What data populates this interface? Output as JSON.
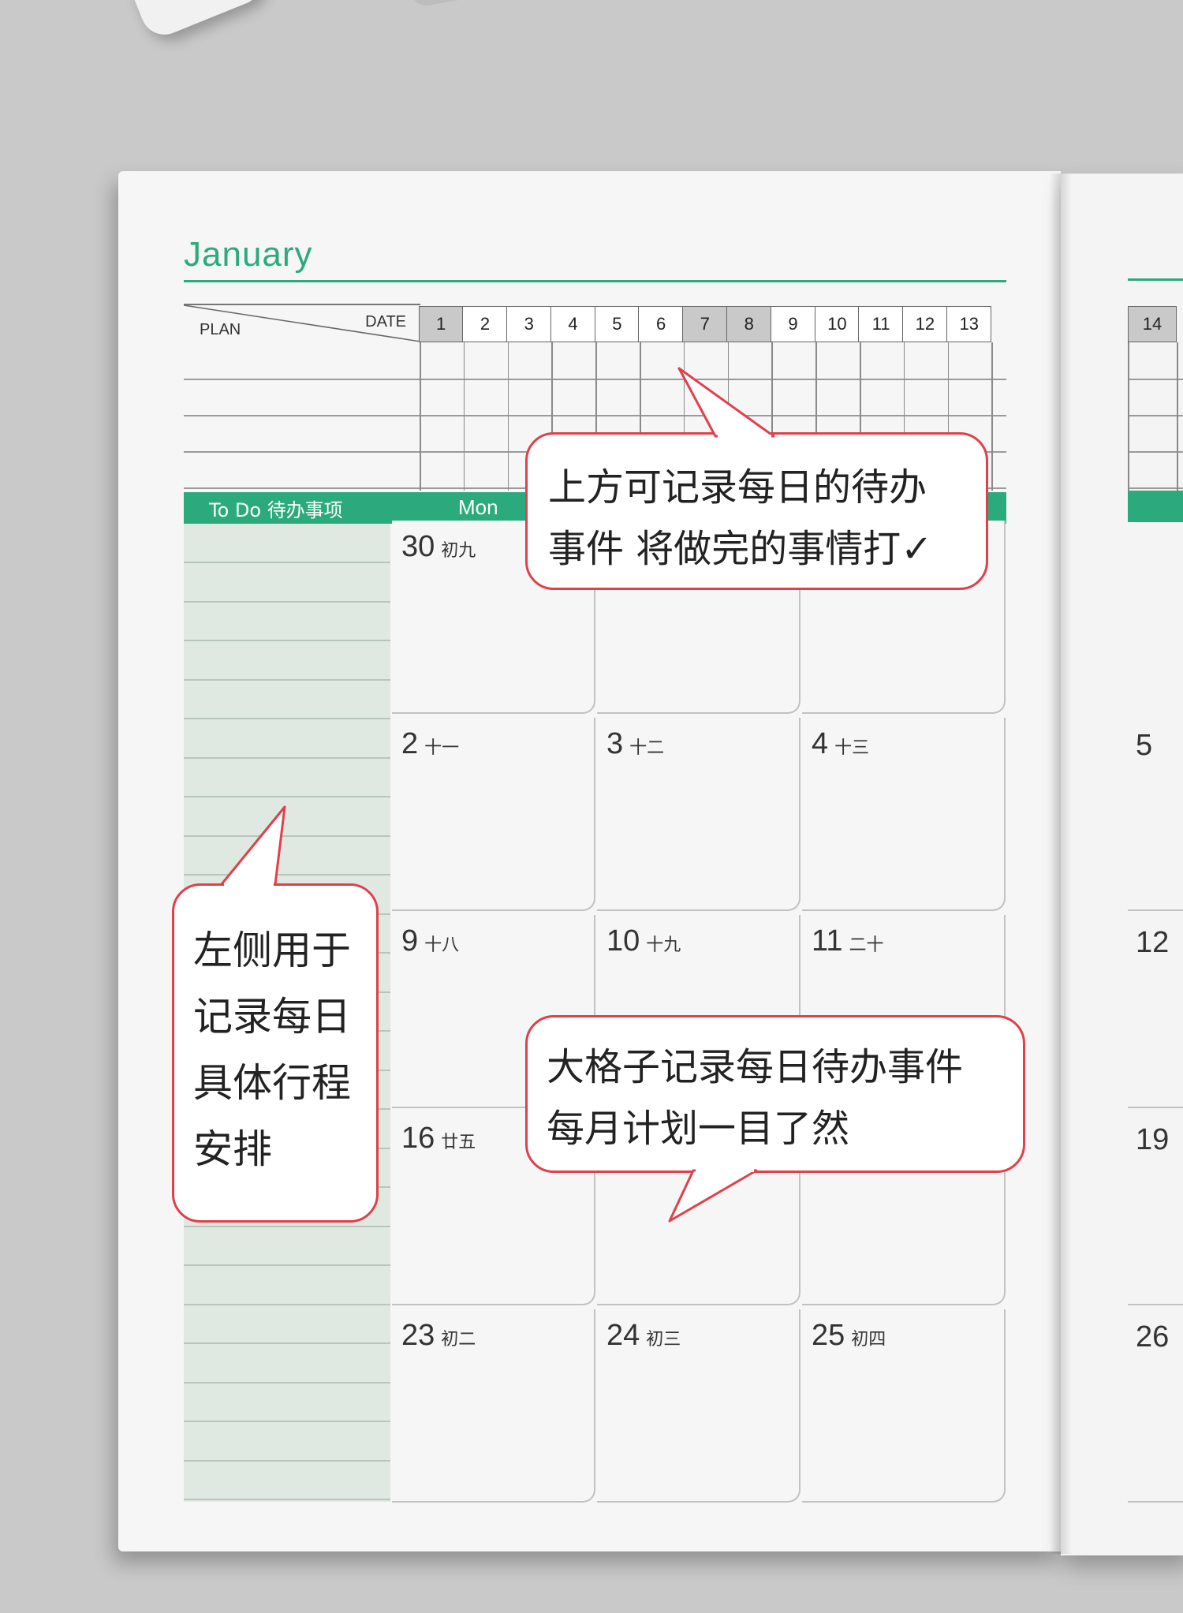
{
  "planner": {
    "month": "January",
    "plan_label": "PLAN",
    "date_label": "DATE",
    "dates": [
      "1",
      "2",
      "3",
      "4",
      "5",
      "6",
      "7",
      "8",
      "9",
      "10",
      "11",
      "12",
      "13"
    ],
    "shaded_dates": [
      "1",
      "7",
      "8"
    ],
    "next_page_date": "14",
    "todo_label": "To Do  待办事项",
    "weekday_label": "Mon",
    "weeks": [
      [
        {
          "day": "30",
          "lunar": "初九"
        },
        {
          "day": "",
          "lunar": ""
        },
        {
          "day": "",
          "lunar": ""
        }
      ],
      [
        {
          "day": "2",
          "lunar": "十一"
        },
        {
          "day": "3",
          "lunar": "十二"
        },
        {
          "day": "4",
          "lunar": "十三"
        }
      ],
      [
        {
          "day": "9",
          "lunar": "十八"
        },
        {
          "day": "10",
          "lunar": "十九"
        },
        {
          "day": "11",
          "lunar": "二十"
        }
      ],
      [
        {
          "day": "16",
          "lunar": "廿五"
        },
        {
          "day": "",
          "lunar": ""
        },
        {
          "day": "",
          "lunar": ""
        }
      ],
      [
        {
          "day": "23",
          "lunar": "初二"
        },
        {
          "day": "24",
          "lunar": "初三"
        },
        {
          "day": "25",
          "lunar": "初四"
        }
      ]
    ],
    "next_page_days": [
      "5",
      "12",
      "19",
      "26"
    ]
  },
  "callouts": {
    "top": [
      "上方可记录每日的待办",
      "事件 将做完的事情打✓"
    ],
    "left": [
      "左侧用于",
      "记录每日",
      "具体行程",
      "安排"
    ],
    "bottom": [
      "大格子记录每日待办事件",
      "每月计划一目了然"
    ]
  },
  "colors": {
    "accent_green": "#2bab7d",
    "todo_bg": "#dfe9e2",
    "callout_border": "#e0404a",
    "background": "#c9c9c9"
  }
}
